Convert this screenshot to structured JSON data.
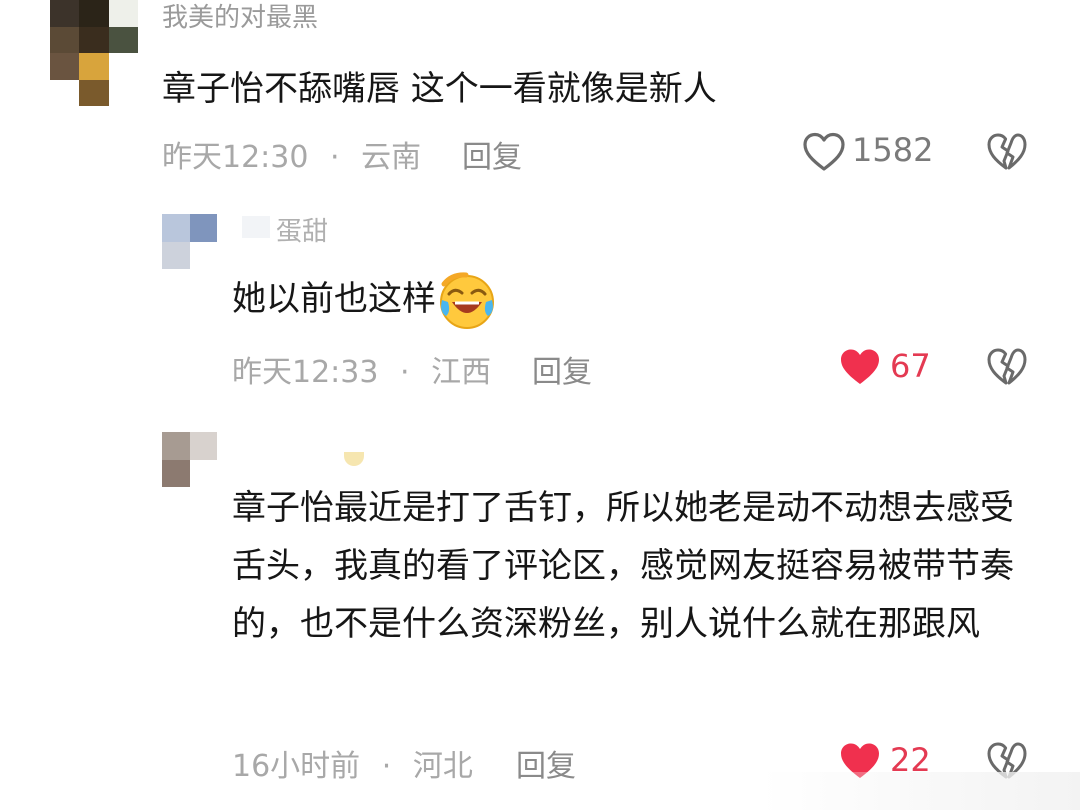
{
  "comments": [
    {
      "username": "我美的对最黑",
      "text": "章子怡不舔嘴唇 这个一看就像是新人",
      "time": "昨天12:30",
      "location": "云南",
      "reply_label": "回复",
      "likes": "1582",
      "liked": false
    },
    {
      "username": "蛋甜",
      "text": "她以前也这样",
      "emoji": "laughing-crying-emoji",
      "time": "昨天12:33",
      "location": "江西",
      "reply_label": "回复",
      "likes": "67",
      "liked": true
    },
    {
      "username": "",
      "text": "章子怡最近是打了舌钉，所以她老是动不动想去感受舌头，我真的看了评论区，感觉网友挺容易被带节奏的，也不是什么资深粉丝，别人说什么就在那跟风",
      "time": "16小时前",
      "location": "河北",
      "reply_label": "回复",
      "likes": "22",
      "liked": true
    }
  ],
  "separator": "·",
  "colors": {
    "liked": "#f0304e",
    "meta": "#a8a8a8",
    "text": "#161616"
  },
  "icons": {
    "like": "heart-icon",
    "dislike": "broken-heart-icon"
  }
}
